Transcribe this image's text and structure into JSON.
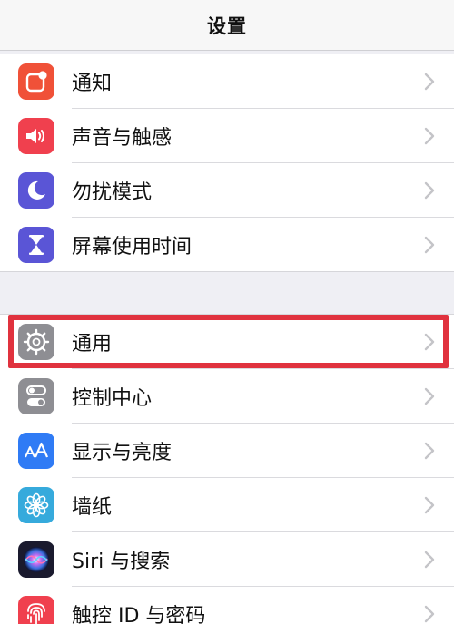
{
  "nav": {
    "title": "设置"
  },
  "groups": [
    {
      "items": [
        {
          "label": "通知",
          "icon": "notifications-icon",
          "color": "#f05138"
        },
        {
          "label": "声音与触感",
          "icon": "speaker-icon",
          "color": "#f0404e"
        },
        {
          "label": "勿扰模式",
          "icon": "moon-icon",
          "color": "#5a55d6"
        },
        {
          "label": "屏幕使用时间",
          "icon": "hourglass-icon",
          "color": "#5a55d6"
        }
      ]
    },
    {
      "items": [
        {
          "label": "通用",
          "icon": "gear-icon",
          "color": "#8e8e93",
          "highlighted": true
        },
        {
          "label": "控制中心",
          "icon": "toggles-icon",
          "color": "#8e8e93"
        },
        {
          "label": "显示与亮度",
          "icon": "text-size-icon",
          "color": "#2f7bf5"
        },
        {
          "label": "墙纸",
          "icon": "flower-icon",
          "color": "#36aadc"
        },
        {
          "label": "Siri 与搜索",
          "icon": "siri-icon",
          "color": "#1a1a2e"
        },
        {
          "label": "触控 ID 与密码",
          "icon": "fingerprint-icon",
          "color": "#f0404e"
        }
      ]
    }
  ],
  "highlight_color": "#e0323e"
}
